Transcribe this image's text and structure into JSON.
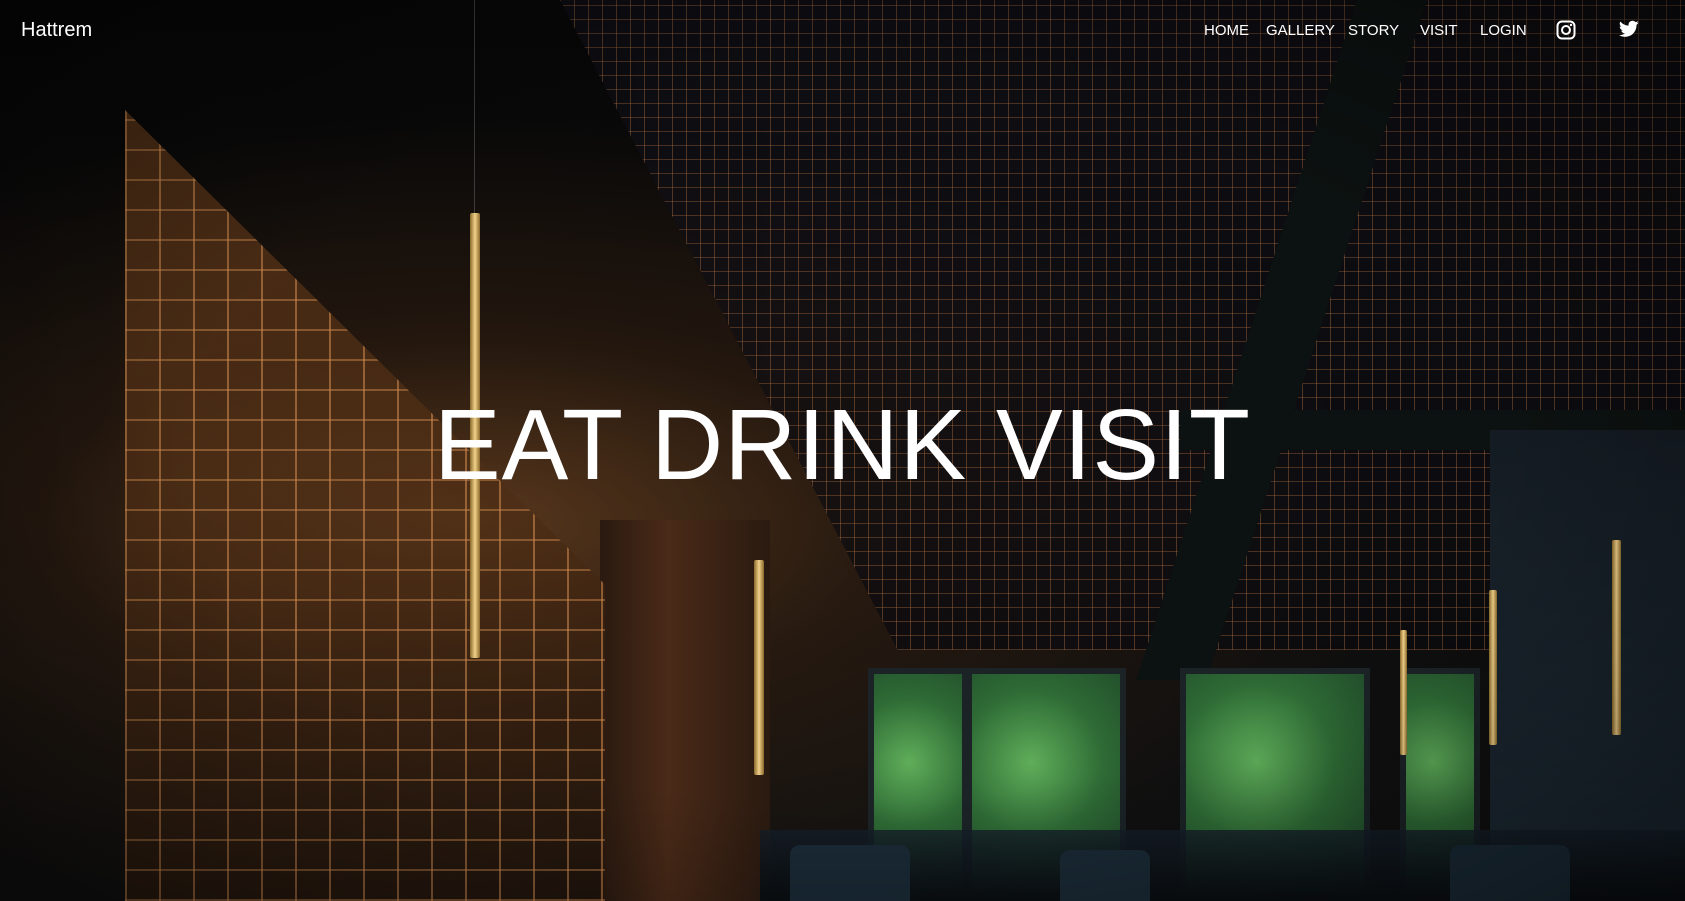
{
  "nav": {
    "brand": "Hattrem",
    "items": [
      {
        "label": "HOME"
      },
      {
        "label": "GALLERY"
      },
      {
        "label": "STORY"
      },
      {
        "label": "VISIT"
      },
      {
        "label": "LOGIN"
      }
    ],
    "social": [
      {
        "icon": "instagram-icon"
      },
      {
        "icon": "twitter-icon"
      }
    ]
  },
  "hero": {
    "headline": "EAT DRINK VISIT"
  },
  "colors": {
    "text": "#ffffff",
    "background": "#050505"
  }
}
